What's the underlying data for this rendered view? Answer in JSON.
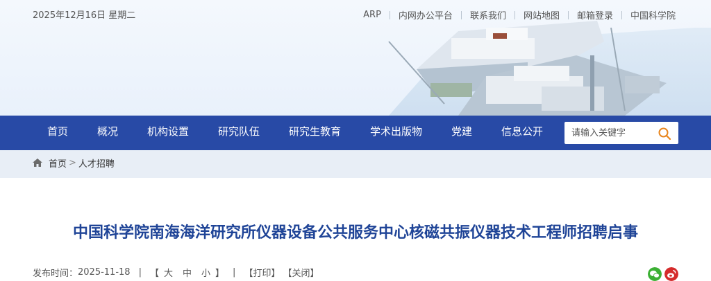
{
  "topbar": {
    "date": "2025年12月16日 星期二",
    "links": [
      "ARP",
      "内网办公平台",
      "联系我们",
      "网站地图",
      "邮箱登录",
      "中国科学院"
    ]
  },
  "nav": {
    "items": [
      "首页",
      "概况",
      "机构设置",
      "研究队伍",
      "研究生教育",
      "学术出版物",
      "党建",
      "信息公开"
    ],
    "search_placeholder": "请输入关键字"
  },
  "breadcrumb": {
    "home": "首页",
    "separator": ">",
    "current": "人才招聘"
  },
  "article": {
    "title": "中国科学院南海海洋研究所仪器设备公共服务中心核磁共振仪器技术工程师招聘启事",
    "publish_label": "发布时间：",
    "publish_date": "2025-11-18",
    "divider": "|",
    "font_open": "【",
    "font_large": "大",
    "font_medium": "中",
    "font_small": "小",
    "font_close": "】",
    "print": "【打印】",
    "close": "【关闭】"
  },
  "share": {
    "icons": [
      "wechat-icon",
      "weibo-icon"
    ],
    "colors": {
      "wechat": "#3cb034",
      "weibo": "#d52b2b"
    }
  },
  "colors": {
    "nav_bg": "#284aa6",
    "title": "#1f4497",
    "breadcrumb_bg": "#e8eef6"
  }
}
